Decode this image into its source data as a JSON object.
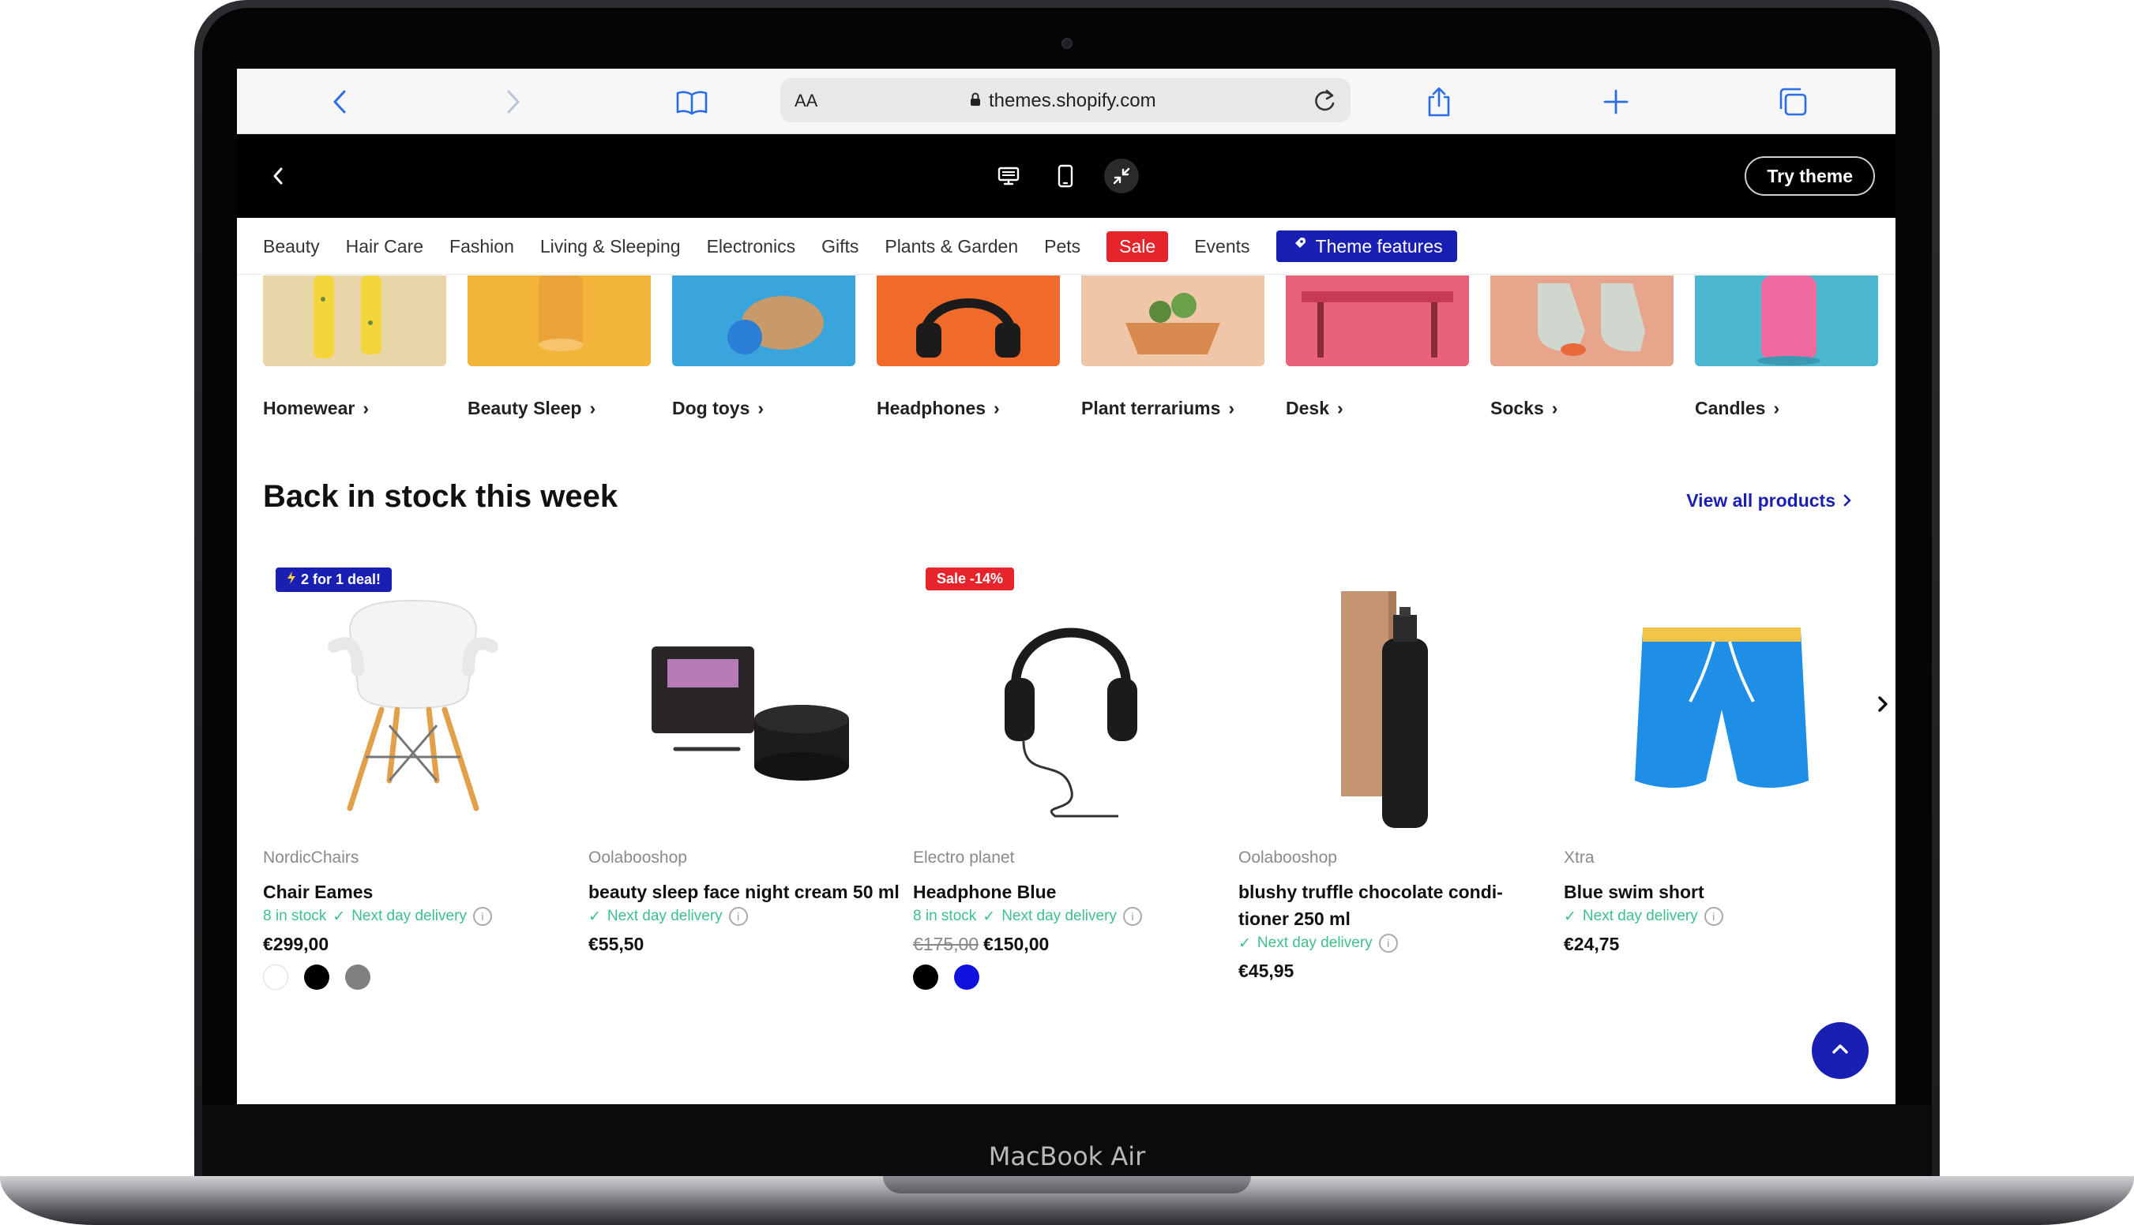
{
  "device": {
    "model_label": "MacBook Air"
  },
  "browser": {
    "reader_label": "AA",
    "url": "themes.shopify.com",
    "icons": [
      "back-icon",
      "forward-icon",
      "bookmarks-icon",
      "lock-icon",
      "reload-icon",
      "share-icon",
      "new-tab-icon",
      "tabs-icon"
    ]
  },
  "preview_bar": {
    "try_theme_label": "Try theme",
    "icons": [
      "back-chevron-icon",
      "desktop-icon",
      "mobile-icon",
      "collapse-icon"
    ]
  },
  "categories": [
    "Beauty",
    "Hair Care",
    "Fashion",
    "Living & Sleeping",
    "Electronics",
    "Gifts",
    "Plants & Garden",
    "Pets",
    "Sale",
    "Events",
    "Theme features"
  ],
  "collections": [
    {
      "label": "Homewear",
      "color": "#e9d6a8"
    },
    {
      "label": "Beauty Sleep",
      "color": "#f2b53a"
    },
    {
      "label": "Dog toys",
      "color": "#3aa5dc"
    },
    {
      "label": "Headphones",
      "color": "#f06a2a"
    },
    {
      "label": "Plant terrariums",
      "color": "#f0c6a9"
    },
    {
      "label": "Desk",
      "color": "#e8627b"
    },
    {
      "label": "Socks",
      "color": "#e7a58c"
    },
    {
      "label": "Candles",
      "color": "#4cb7cf"
    }
  ],
  "section": {
    "title": "Back in stock this week",
    "view_all": "View all products"
  },
  "products": [
    {
      "badge": "2 for 1 deal!",
      "vendor": "NordicChairs",
      "title": "Chair Eames",
      "stock": "8 in stock",
      "delivery": "Next day delivery",
      "price": "€299,00",
      "swatches": [
        "#ffffff",
        "#000000",
        "#808080"
      ]
    },
    {
      "vendor": "Oolaboo​shop",
      "title": "beauty sleep face night cream 50 ml",
      "delivery": "Next day delivery",
      "price": "€55,50"
    },
    {
      "badge": "Sale -14%",
      "vendor": "Electro planet",
      "title": "Headphone Blue",
      "stock": "8 in stock",
      "delivery": "Next day delivery",
      "old_price": "€175,00",
      "price": "€150,00",
      "swatches": [
        "#000000",
        "#1111dd"
      ]
    },
    {
      "vendor": "Oolaboo​shop",
      "title": "blushy truffle chocolate condi- tioner 250 ml",
      "delivery": "Next day delivery",
      "price": "€45,95"
    },
    {
      "vendor": "Xtra",
      "title": "Blue swim short",
      "delivery": "Next day delivery",
      "price": "€24,75"
    }
  ],
  "colors": {
    "accent": "#1a1fb4",
    "sale": "#e5242b",
    "stock": "#3ec08a"
  }
}
